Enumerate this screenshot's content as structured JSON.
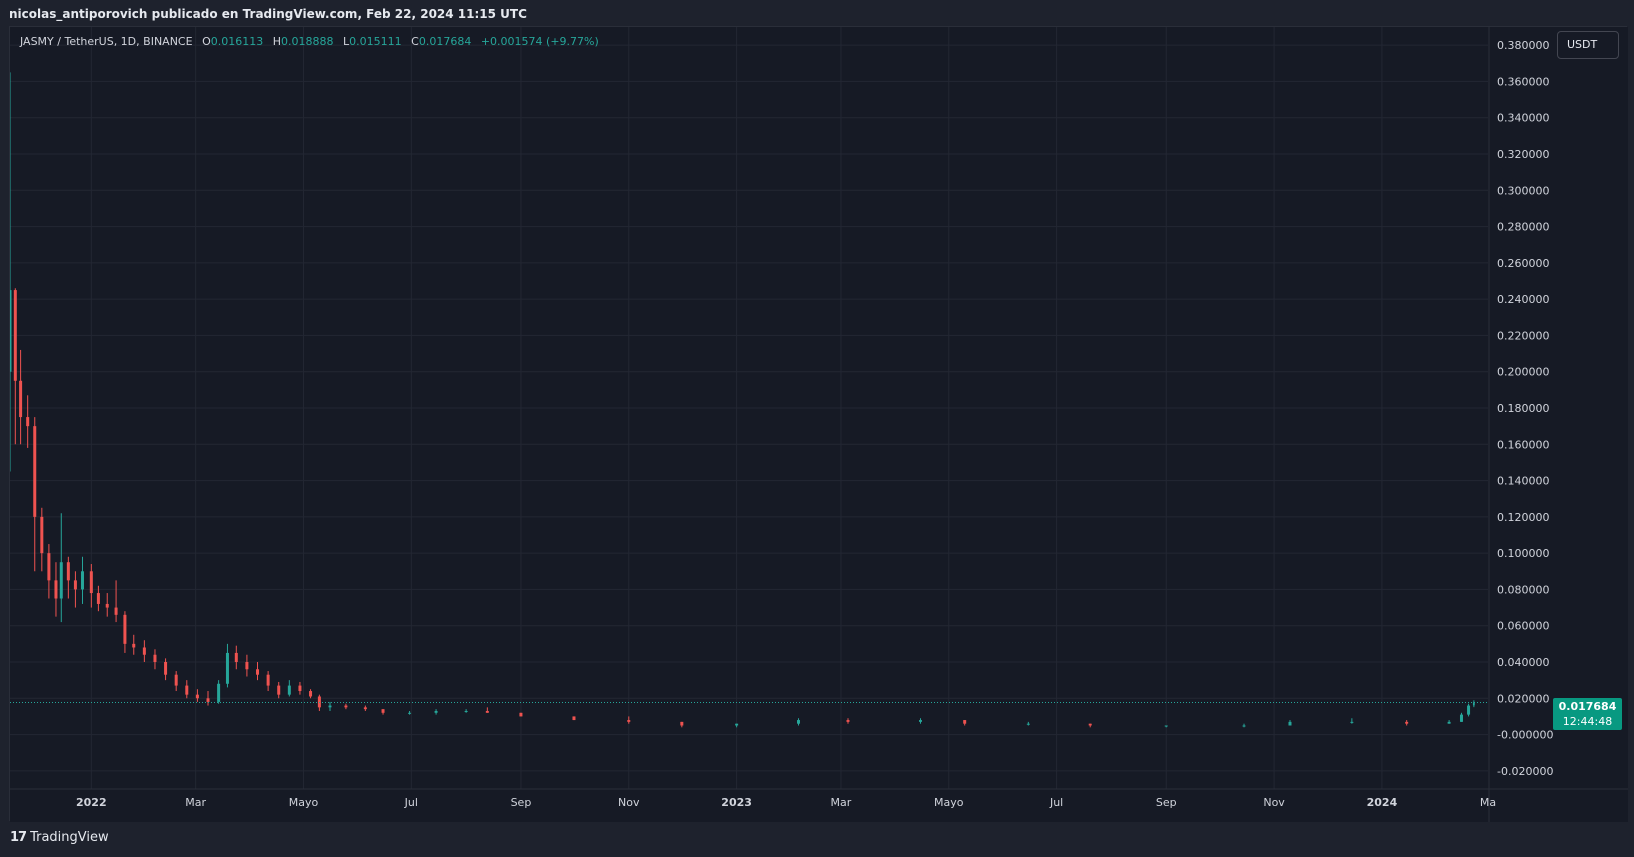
{
  "header": {
    "attribution": "nicolas_antiporovich publicado en TradingView.com, Feb 22, 2024 11:15 UTC"
  },
  "legend": {
    "symbol": "JASMY / TetherUS, 1D, BINANCE",
    "o_label": "O",
    "o_value": "0.016113",
    "h_label": "H",
    "h_value": "0.018888",
    "l_label": "L",
    "l_value": "0.015111",
    "c_label": "C",
    "c_value": "0.017684",
    "change": "+0.001574 (+9.77%)"
  },
  "unit_button": "USDT",
  "price_tag": {
    "price": "0.017684",
    "countdown": "12:44:48"
  },
  "footer": {
    "logo": "17",
    "brand": "TradingView"
  },
  "colors": {
    "background": "#161a25",
    "grid": "#232733",
    "up": "#26a69a",
    "down": "#ef5350",
    "price_line": "#26a69a",
    "price_tag": "#089981"
  },
  "chart_data": {
    "type": "candlestick",
    "ylim": [
      -0.03,
      0.39
    ],
    "y_ticks": [
      0.38,
      0.36,
      0.34,
      0.32,
      0.3,
      0.28,
      0.26,
      0.24,
      0.22,
      0.2,
      0.18,
      0.16,
      0.14,
      0.12,
      0.1,
      0.08,
      0.06,
      0.04,
      0.02,
      0.0,
      -0.02
    ],
    "y_tick_labels": [
      "0.380000",
      "0.360000",
      "0.340000",
      "0.320000",
      "0.300000",
      "0.280000",
      "0.260000",
      "0.240000",
      "0.220000",
      "0.200000",
      "0.180000",
      "0.160000",
      "0.140000",
      "0.120000",
      "0.100000",
      "0.080000",
      "0.060000",
      "0.040000",
      "0.020000",
      "-0.000000",
      "-0.020000"
    ],
    "x_ticks": [
      {
        "label": "2022",
        "date": "2022-01-01",
        "bold": true
      },
      {
        "label": "Mar",
        "date": "2022-03-01",
        "bold": false
      },
      {
        "label": "Mayo",
        "date": "2022-05-01",
        "bold": false
      },
      {
        "label": "Jul",
        "date": "2022-07-01",
        "bold": false
      },
      {
        "label": "Sep",
        "date": "2022-09-01",
        "bold": false
      },
      {
        "label": "Nov",
        "date": "2022-11-01",
        "bold": false
      },
      {
        "label": "2023",
        "date": "2023-01-01",
        "bold": true
      },
      {
        "label": "Mar",
        "date": "2023-03-01",
        "bold": false
      },
      {
        "label": "Mayo",
        "date": "2023-05-01",
        "bold": false
      },
      {
        "label": "Jul",
        "date": "2023-07-01",
        "bold": false
      },
      {
        "label": "Sep",
        "date": "2023-09-01",
        "bold": false
      },
      {
        "label": "Nov",
        "date": "2023-11-01",
        "bold": false
      },
      {
        "label": "2024",
        "date": "2024-01-01",
        "bold": true
      },
      {
        "label": "Ma",
        "date": "2024-03-01",
        "bold": false
      }
    ],
    "x_range": [
      "2021-11-16",
      "2024-03-01"
    ],
    "last_price": 0.017684,
    "grid": true,
    "series": [
      {
        "date": "2021-11-16",
        "open": 0.2,
        "high": 0.365,
        "low": 0.145,
        "close": 0.245
      },
      {
        "date": "2021-11-19",
        "open": 0.245,
        "high": 0.246,
        "low": 0.16,
        "close": 0.195
      },
      {
        "date": "2021-11-22",
        "open": 0.195,
        "high": 0.212,
        "low": 0.16,
        "close": 0.175
      },
      {
        "date": "2021-11-26",
        "open": 0.175,
        "high": 0.187,
        "low": 0.158,
        "close": 0.17
      },
      {
        "date": "2021-11-30",
        "open": 0.17,
        "high": 0.175,
        "low": 0.09,
        "close": 0.12
      },
      {
        "date": "2021-12-04",
        "open": 0.12,
        "high": 0.125,
        "low": 0.09,
        "close": 0.1
      },
      {
        "date": "2021-12-08",
        "open": 0.1,
        "high": 0.105,
        "low": 0.075,
        "close": 0.085
      },
      {
        "date": "2021-12-12",
        "open": 0.085,
        "high": 0.095,
        "low": 0.065,
        "close": 0.075
      },
      {
        "date": "2021-12-15",
        "open": 0.075,
        "high": 0.122,
        "low": 0.062,
        "close": 0.095
      },
      {
        "date": "2021-12-19",
        "open": 0.095,
        "high": 0.098,
        "low": 0.075,
        "close": 0.085
      },
      {
        "date": "2021-12-23",
        "open": 0.085,
        "high": 0.09,
        "low": 0.07,
        "close": 0.08
      },
      {
        "date": "2021-12-27",
        "open": 0.08,
        "high": 0.098,
        "low": 0.072,
        "close": 0.09
      },
      {
        "date": "2022-01-01",
        "open": 0.09,
        "high": 0.094,
        "low": 0.07,
        "close": 0.078
      },
      {
        "date": "2022-01-05",
        "open": 0.078,
        "high": 0.082,
        "low": 0.068,
        "close": 0.072
      },
      {
        "date": "2022-01-10",
        "open": 0.072,
        "high": 0.078,
        "low": 0.065,
        "close": 0.07
      },
      {
        "date": "2022-01-15",
        "open": 0.07,
        "high": 0.085,
        "low": 0.062,
        "close": 0.066
      },
      {
        "date": "2022-01-20",
        "open": 0.066,
        "high": 0.068,
        "low": 0.045,
        "close": 0.05
      },
      {
        "date": "2022-01-25",
        "open": 0.05,
        "high": 0.055,
        "low": 0.044,
        "close": 0.048
      },
      {
        "date": "2022-01-31",
        "open": 0.048,
        "high": 0.052,
        "low": 0.04,
        "close": 0.044
      },
      {
        "date": "2022-02-06",
        "open": 0.044,
        "high": 0.047,
        "low": 0.036,
        "close": 0.04
      },
      {
        "date": "2022-02-12",
        "open": 0.04,
        "high": 0.042,
        "low": 0.03,
        "close": 0.033
      },
      {
        "date": "2022-02-18",
        "open": 0.033,
        "high": 0.035,
        "low": 0.024,
        "close": 0.027
      },
      {
        "date": "2022-02-24",
        "open": 0.027,
        "high": 0.03,
        "low": 0.02,
        "close": 0.022
      },
      {
        "date": "2022-03-02",
        "open": 0.022,
        "high": 0.025,
        "low": 0.018,
        "close": 0.02
      },
      {
        "date": "2022-03-08",
        "open": 0.02,
        "high": 0.024,
        "low": 0.016,
        "close": 0.018
      },
      {
        "date": "2022-03-14",
        "open": 0.018,
        "high": 0.03,
        "low": 0.017,
        "close": 0.028
      },
      {
        "date": "2022-03-19",
        "open": 0.028,
        "high": 0.05,
        "low": 0.026,
        "close": 0.045
      },
      {
        "date": "2022-03-24",
        "open": 0.045,
        "high": 0.049,
        "low": 0.036,
        "close": 0.04
      },
      {
        "date": "2022-03-30",
        "open": 0.04,
        "high": 0.044,
        "low": 0.032,
        "close": 0.036
      },
      {
        "date": "2022-04-05",
        "open": 0.036,
        "high": 0.04,
        "low": 0.03,
        "close": 0.033
      },
      {
        "date": "2022-04-11",
        "open": 0.033,
        "high": 0.035,
        "low": 0.024,
        "close": 0.027
      },
      {
        "date": "2022-04-17",
        "open": 0.027,
        "high": 0.029,
        "low": 0.02,
        "close": 0.022
      },
      {
        "date": "2022-04-23",
        "open": 0.022,
        "high": 0.03,
        "low": 0.021,
        "close": 0.027
      },
      {
        "date": "2022-04-29",
        "open": 0.027,
        "high": 0.029,
        "low": 0.022,
        "close": 0.024
      },
      {
        "date": "2022-05-05",
        "open": 0.024,
        "high": 0.025,
        "low": 0.02,
        "close": 0.021
      },
      {
        "date": "2022-05-10",
        "open": 0.021,
        "high": 0.022,
        "low": 0.013,
        "close": 0.015
      },
      {
        "date": "2022-05-16",
        "open": 0.015,
        "high": 0.018,
        "low": 0.013,
        "close": 0.016
      },
      {
        "date": "2022-05-25",
        "open": 0.016,
        "high": 0.017,
        "low": 0.014,
        "close": 0.015
      },
      {
        "date": "2022-06-05",
        "open": 0.015,
        "high": 0.016,
        "low": 0.013,
        "close": 0.014
      },
      {
        "date": "2022-06-15",
        "open": 0.014,
        "high": 0.014,
        "low": 0.011,
        "close": 0.012
      },
      {
        "date": "2022-06-30",
        "open": 0.012,
        "high": 0.013,
        "low": 0.011,
        "close": 0.012
      },
      {
        "date": "2022-07-15",
        "open": 0.012,
        "high": 0.014,
        "low": 0.011,
        "close": 0.013
      },
      {
        "date": "2022-08-01",
        "open": 0.013,
        "high": 0.014,
        "low": 0.012,
        "close": 0.013
      },
      {
        "date": "2022-08-13",
        "open": 0.013,
        "high": 0.015,
        "low": 0.012,
        "close": 0.012
      },
      {
        "date": "2022-09-01",
        "open": 0.012,
        "high": 0.012,
        "low": 0.01,
        "close": 0.01
      },
      {
        "date": "2022-10-01",
        "open": 0.01,
        "high": 0.01,
        "low": 0.008,
        "close": 0.008
      },
      {
        "date": "2022-11-01",
        "open": 0.008,
        "high": 0.01,
        "low": 0.006,
        "close": 0.007
      },
      {
        "date": "2022-12-01",
        "open": 0.007,
        "high": 0.007,
        "low": 0.004,
        "close": 0.005
      },
      {
        "date": "2023-01-01",
        "open": 0.005,
        "high": 0.006,
        "low": 0.004,
        "close": 0.006
      },
      {
        "date": "2023-02-05",
        "open": 0.006,
        "high": 0.009,
        "low": 0.005,
        "close": 0.008
      },
      {
        "date": "2023-03-05",
        "open": 0.008,
        "high": 0.009,
        "low": 0.006,
        "close": 0.007
      },
      {
        "date": "2023-04-15",
        "open": 0.007,
        "high": 0.009,
        "low": 0.006,
        "close": 0.008
      },
      {
        "date": "2023-05-10",
        "open": 0.008,
        "high": 0.008,
        "low": 0.005,
        "close": 0.006
      },
      {
        "date": "2023-06-15",
        "open": 0.006,
        "high": 0.007,
        "low": 0.005,
        "close": 0.006
      },
      {
        "date": "2023-07-20",
        "open": 0.006,
        "high": 0.006,
        "low": 0.004,
        "close": 0.005
      },
      {
        "date": "2023-09-01",
        "open": 0.005,
        "high": 0.005,
        "low": 0.004,
        "close": 0.005
      },
      {
        "date": "2023-10-15",
        "open": 0.005,
        "high": 0.006,
        "low": 0.004,
        "close": 0.005
      },
      {
        "date": "2023-11-10",
        "open": 0.005,
        "high": 0.008,
        "low": 0.005,
        "close": 0.007
      },
      {
        "date": "2023-12-15",
        "open": 0.007,
        "high": 0.009,
        "low": 0.006,
        "close": 0.007
      },
      {
        "date": "2024-01-15",
        "open": 0.007,
        "high": 0.008,
        "low": 0.005,
        "close": 0.006
      },
      {
        "date": "2024-02-08",
        "open": 0.006,
        "high": 0.008,
        "low": 0.006,
        "close": 0.007
      },
      {
        "date": "2024-02-15",
        "open": 0.007,
        "high": 0.012,
        "low": 0.007,
        "close": 0.011
      },
      {
        "date": "2024-02-19",
        "open": 0.011,
        "high": 0.017,
        "low": 0.01,
        "close": 0.016
      },
      {
        "date": "2024-02-22",
        "open": 0.016113,
        "high": 0.018888,
        "low": 0.015111,
        "close": 0.017684
      }
    ]
  }
}
